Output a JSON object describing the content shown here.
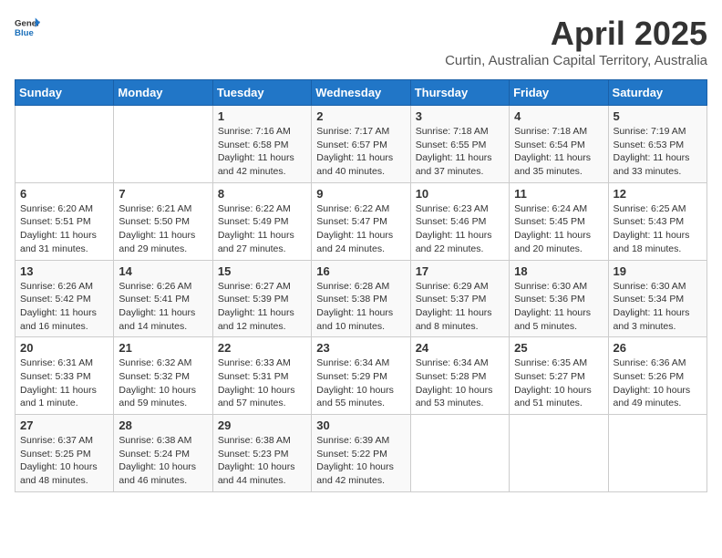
{
  "header": {
    "logo_general": "General",
    "logo_blue": "Blue",
    "title": "April 2025",
    "subtitle": "Curtin, Australian Capital Territory, Australia"
  },
  "days_of_week": [
    "Sunday",
    "Monday",
    "Tuesday",
    "Wednesday",
    "Thursday",
    "Friday",
    "Saturday"
  ],
  "weeks": [
    [
      {
        "day": "",
        "info": ""
      },
      {
        "day": "",
        "info": ""
      },
      {
        "day": "1",
        "info": "Sunrise: 7:16 AM\nSunset: 6:58 PM\nDaylight: 11 hours and 42 minutes."
      },
      {
        "day": "2",
        "info": "Sunrise: 7:17 AM\nSunset: 6:57 PM\nDaylight: 11 hours and 40 minutes."
      },
      {
        "day": "3",
        "info": "Sunrise: 7:18 AM\nSunset: 6:55 PM\nDaylight: 11 hours and 37 minutes."
      },
      {
        "day": "4",
        "info": "Sunrise: 7:18 AM\nSunset: 6:54 PM\nDaylight: 11 hours and 35 minutes."
      },
      {
        "day": "5",
        "info": "Sunrise: 7:19 AM\nSunset: 6:53 PM\nDaylight: 11 hours and 33 minutes."
      }
    ],
    [
      {
        "day": "6",
        "info": "Sunrise: 6:20 AM\nSunset: 5:51 PM\nDaylight: 11 hours and 31 minutes."
      },
      {
        "day": "7",
        "info": "Sunrise: 6:21 AM\nSunset: 5:50 PM\nDaylight: 11 hours and 29 minutes."
      },
      {
        "day": "8",
        "info": "Sunrise: 6:22 AM\nSunset: 5:49 PM\nDaylight: 11 hours and 27 minutes."
      },
      {
        "day": "9",
        "info": "Sunrise: 6:22 AM\nSunset: 5:47 PM\nDaylight: 11 hours and 24 minutes."
      },
      {
        "day": "10",
        "info": "Sunrise: 6:23 AM\nSunset: 5:46 PM\nDaylight: 11 hours and 22 minutes."
      },
      {
        "day": "11",
        "info": "Sunrise: 6:24 AM\nSunset: 5:45 PM\nDaylight: 11 hours and 20 minutes."
      },
      {
        "day": "12",
        "info": "Sunrise: 6:25 AM\nSunset: 5:43 PM\nDaylight: 11 hours and 18 minutes."
      }
    ],
    [
      {
        "day": "13",
        "info": "Sunrise: 6:26 AM\nSunset: 5:42 PM\nDaylight: 11 hours and 16 minutes."
      },
      {
        "day": "14",
        "info": "Sunrise: 6:26 AM\nSunset: 5:41 PM\nDaylight: 11 hours and 14 minutes."
      },
      {
        "day": "15",
        "info": "Sunrise: 6:27 AM\nSunset: 5:39 PM\nDaylight: 11 hours and 12 minutes."
      },
      {
        "day": "16",
        "info": "Sunrise: 6:28 AM\nSunset: 5:38 PM\nDaylight: 11 hours and 10 minutes."
      },
      {
        "day": "17",
        "info": "Sunrise: 6:29 AM\nSunset: 5:37 PM\nDaylight: 11 hours and 8 minutes."
      },
      {
        "day": "18",
        "info": "Sunrise: 6:30 AM\nSunset: 5:36 PM\nDaylight: 11 hours and 5 minutes."
      },
      {
        "day": "19",
        "info": "Sunrise: 6:30 AM\nSunset: 5:34 PM\nDaylight: 11 hours and 3 minutes."
      }
    ],
    [
      {
        "day": "20",
        "info": "Sunrise: 6:31 AM\nSunset: 5:33 PM\nDaylight: 11 hours and 1 minute."
      },
      {
        "day": "21",
        "info": "Sunrise: 6:32 AM\nSunset: 5:32 PM\nDaylight: 10 hours and 59 minutes."
      },
      {
        "day": "22",
        "info": "Sunrise: 6:33 AM\nSunset: 5:31 PM\nDaylight: 10 hours and 57 minutes."
      },
      {
        "day": "23",
        "info": "Sunrise: 6:34 AM\nSunset: 5:29 PM\nDaylight: 10 hours and 55 minutes."
      },
      {
        "day": "24",
        "info": "Sunrise: 6:34 AM\nSunset: 5:28 PM\nDaylight: 10 hours and 53 minutes."
      },
      {
        "day": "25",
        "info": "Sunrise: 6:35 AM\nSunset: 5:27 PM\nDaylight: 10 hours and 51 minutes."
      },
      {
        "day": "26",
        "info": "Sunrise: 6:36 AM\nSunset: 5:26 PM\nDaylight: 10 hours and 49 minutes."
      }
    ],
    [
      {
        "day": "27",
        "info": "Sunrise: 6:37 AM\nSunset: 5:25 PM\nDaylight: 10 hours and 48 minutes."
      },
      {
        "day": "28",
        "info": "Sunrise: 6:38 AM\nSunset: 5:24 PM\nDaylight: 10 hours and 46 minutes."
      },
      {
        "day": "29",
        "info": "Sunrise: 6:38 AM\nSunset: 5:23 PM\nDaylight: 10 hours and 44 minutes."
      },
      {
        "day": "30",
        "info": "Sunrise: 6:39 AM\nSunset: 5:22 PM\nDaylight: 10 hours and 42 minutes."
      },
      {
        "day": "",
        "info": ""
      },
      {
        "day": "",
        "info": ""
      },
      {
        "day": "",
        "info": ""
      }
    ]
  ]
}
